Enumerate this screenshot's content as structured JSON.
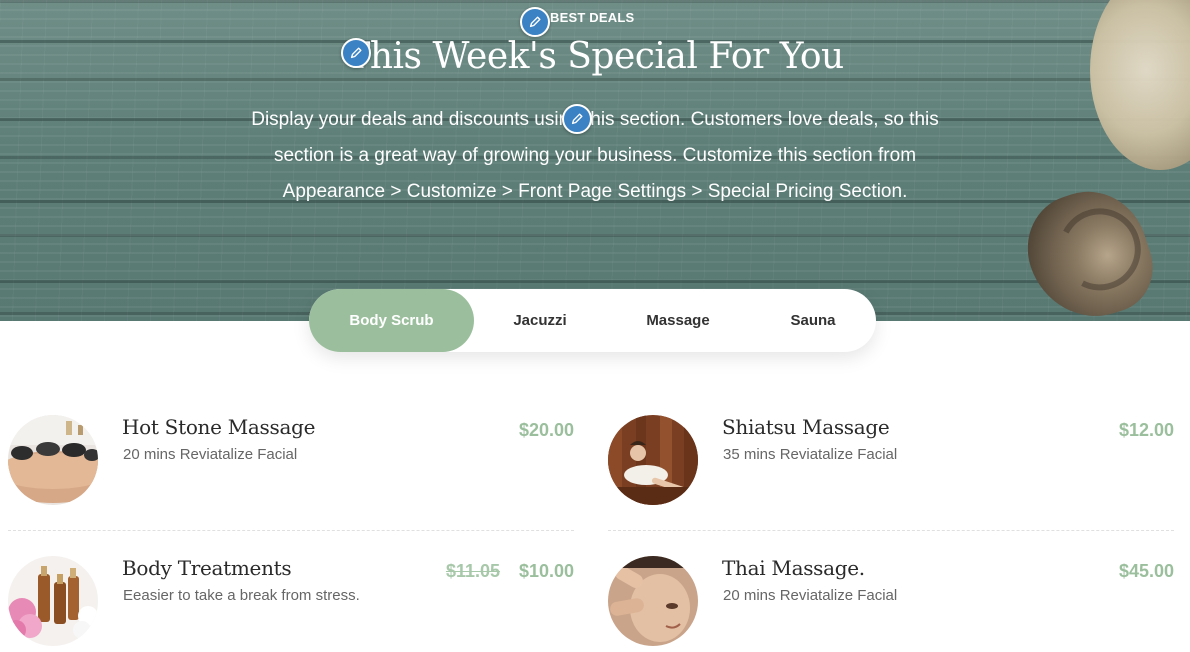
{
  "hero": {
    "eyebrow": "BEST DEALS",
    "title": "This Week's Special For You",
    "description": "Display your deals and discounts using this section. Customers love deals, so this section is a great way of growing your business. Customize this section from Appearance > Customize > Front Page Settings > Special Pricing Section."
  },
  "tabs": [
    {
      "label": "Body Scrub",
      "active": true
    },
    {
      "label": "Jacuzzi",
      "active": false
    },
    {
      "label": "Massage",
      "active": false
    },
    {
      "label": "Sauna",
      "active": false
    }
  ],
  "items": [
    {
      "name": "Hot Stone Massage",
      "subtitle": "20 mins Reviatalize Facial",
      "price": "$20.00",
      "old_price": ""
    },
    {
      "name": "Shiatsu Massage",
      "subtitle": "35 mins Reviatalize Facial",
      "price": "$12.00",
      "old_price": ""
    },
    {
      "name": "Body Treatments",
      "subtitle": "Eeasier to take a break from stress.",
      "price": "$10.00",
      "old_price": "$11.05"
    },
    {
      "name": "Thai Massage.",
      "subtitle": "20 mins Reviatalize Facial",
      "price": "$45.00",
      "old_price": ""
    }
  ],
  "colors": {
    "accent": "#9bbf9d",
    "edit_pencil": "#3b82c4",
    "hero_bg": "#6f8e87"
  },
  "icons": {
    "edit": "pencil-icon"
  }
}
